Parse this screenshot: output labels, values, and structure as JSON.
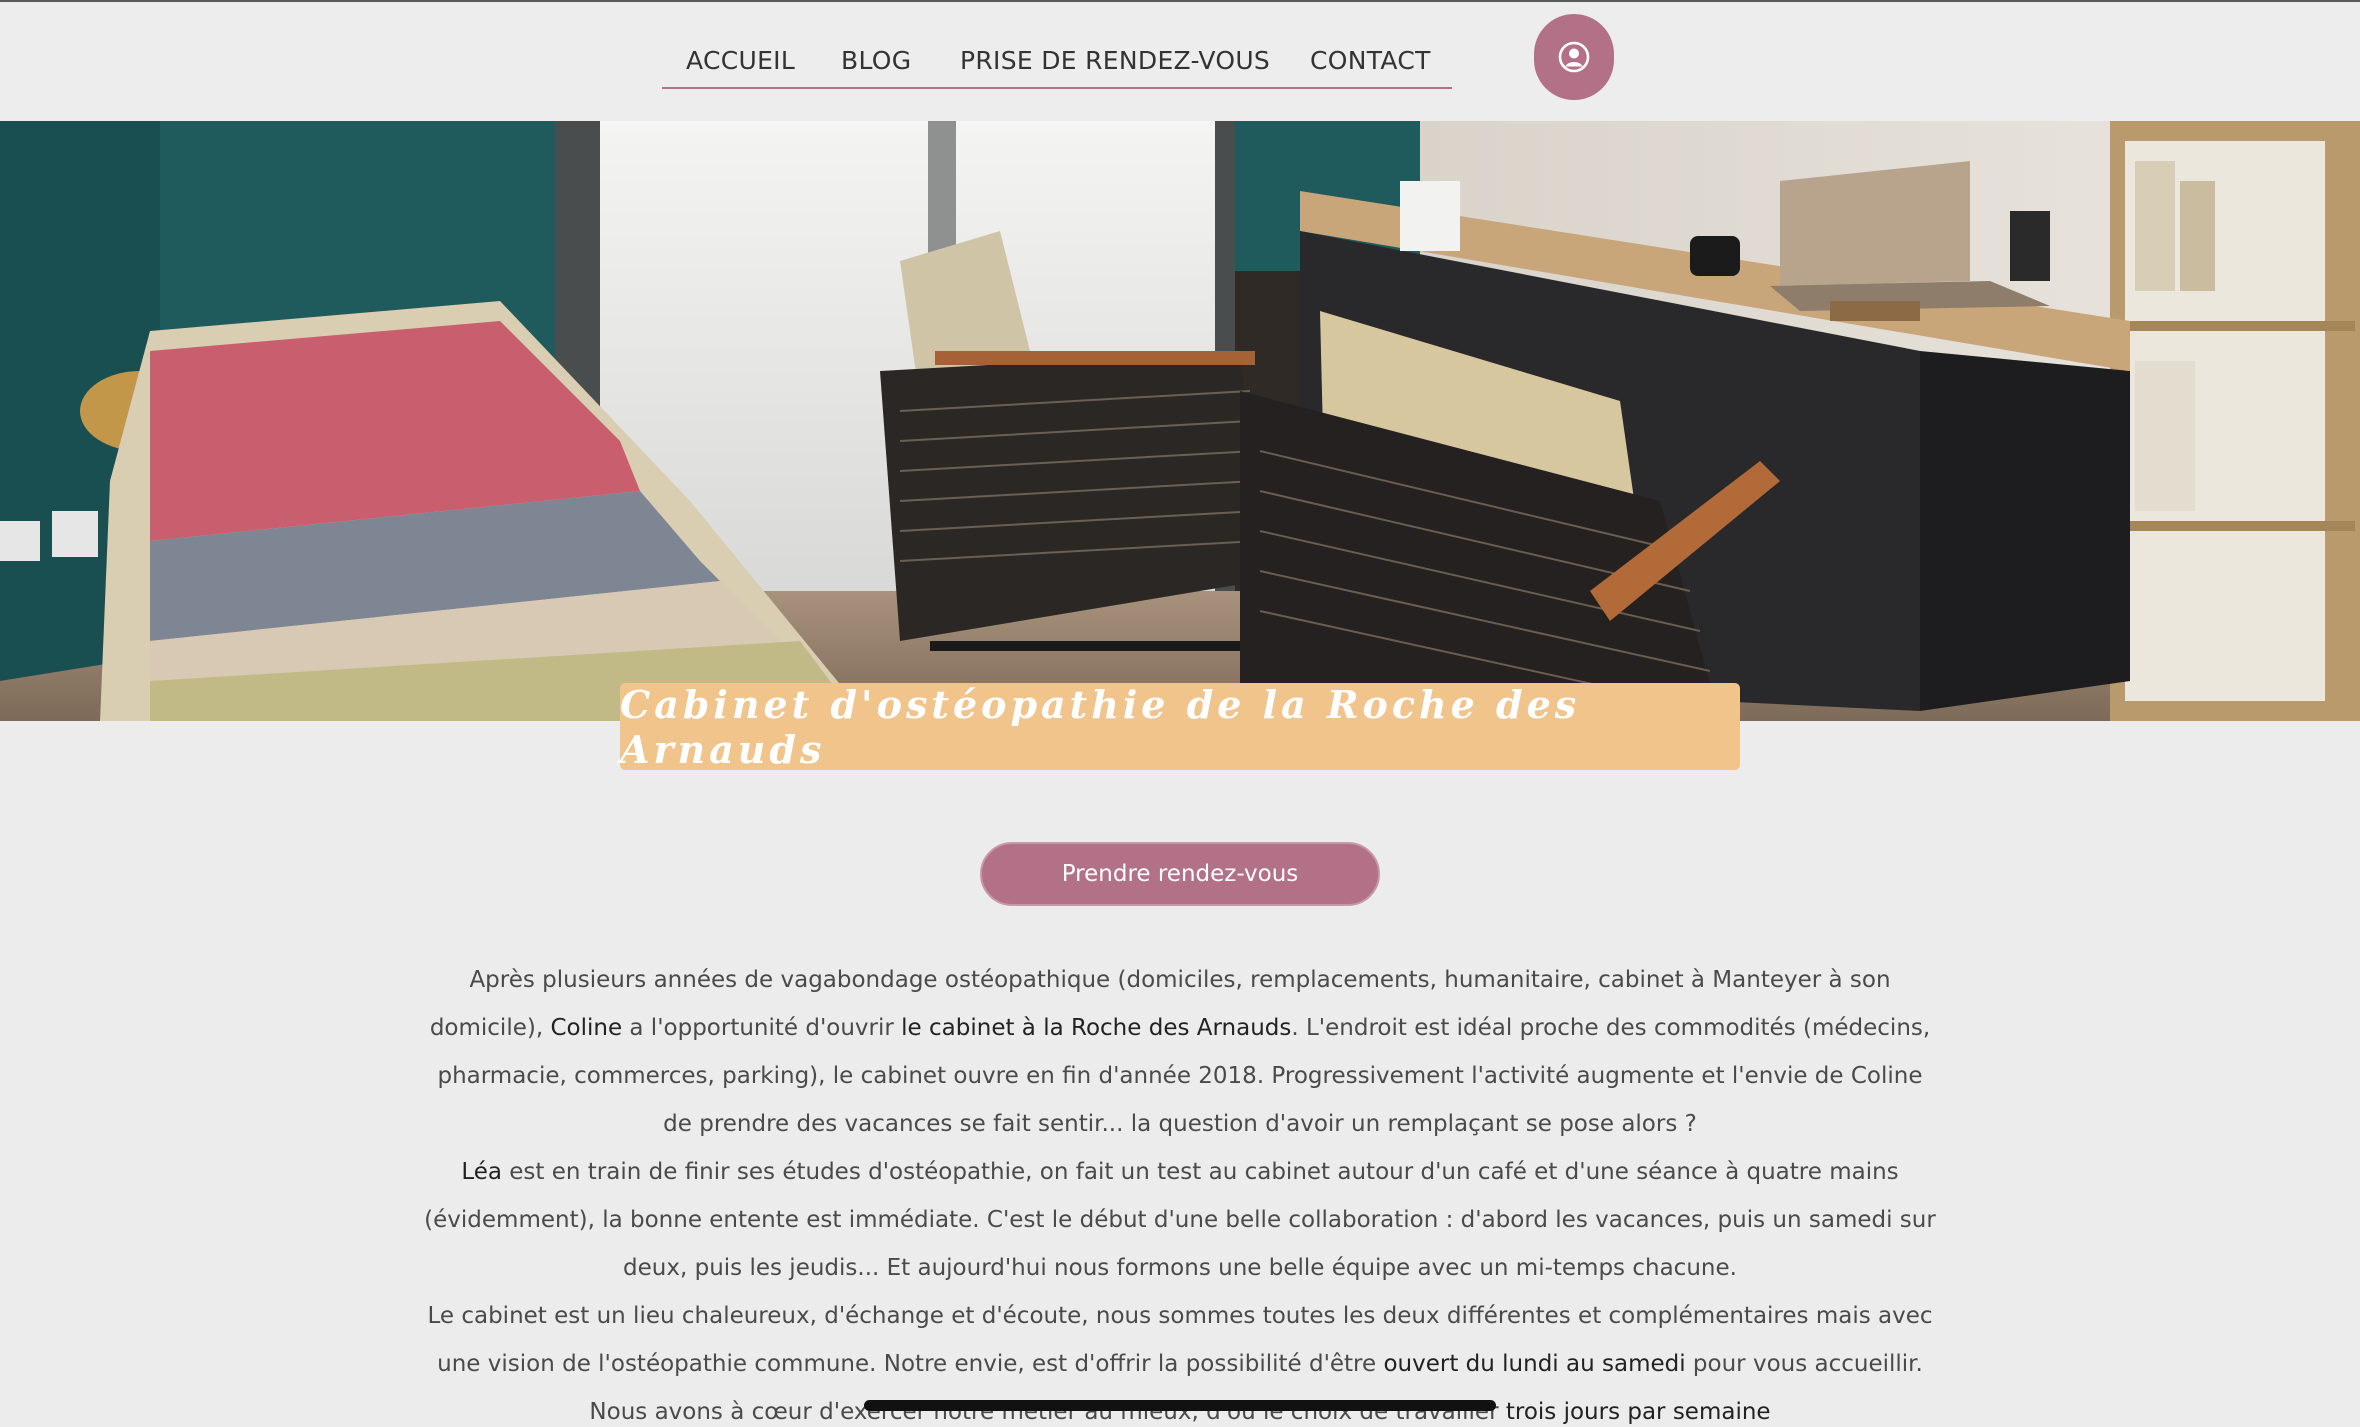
{
  "nav": {
    "items": [
      "ACCUEIL",
      "BLOG",
      "PRISE DE RENDEZ-VOUS",
      "CONTACT"
    ]
  },
  "hero": {
    "title": "Cabinet d'ostéopathie de la Roche des Arnauds"
  },
  "cta": {
    "label": "Prendre rendez-vous"
  },
  "content": {
    "p1_a": "Après plusieurs années de vagabondage ostéopathique (domiciles, remplacements, humanitaire, cabinet à Manteyer à son domicile), ",
    "p1_b": "Coline",
    "p1_c": " a l'opportunité d'ouvrir ",
    "p1_d": "le cabinet à la Roche des Arnauds",
    "p1_e": ". L'endroit est idéal proche des commodités (médecins, pharmacie, commerces, parking), le cabinet ouvre en fin d'année 2018. Progressivement l'activité augmente et l'envie de Coline de prendre des vacances se fait sentir... la question d'avoir un remplaçant se pose alors ?",
    "p2_a": "Léa",
    "p2_b": " est en train de finir ses études d'ostéopathie, on fait un test au cabinet autour d'un café et d'une séance à quatre mains (évidemment), la bonne entente est immédiate. C'est le début d'une belle collaboration : d'abord les vacances, puis un samedi sur deux, puis les jeudis... Et aujourd'hui nous formons une belle équipe avec un mi-temps chacune.",
    "p3_a": "Le cabinet est un lieu chaleureux, d'échange et d'écoute, nous sommes toutes les deux différentes et complémentaires mais avec une vision de l'ostéopathie commune. Notre envie, est d'offrir la possibilité d'être ",
    "p3_b": "ouvert du lundi au samedi",
    "p3_c": " pour vous accueillir. Nous avons à cœur d'exercer notre métier au mieux, d'où le choix de travailler ",
    "p3_d": "trois jours par semaine"
  },
  "colors": {
    "accent": "#b37188",
    "banner": "#f1c48c",
    "background": "#ececec"
  }
}
